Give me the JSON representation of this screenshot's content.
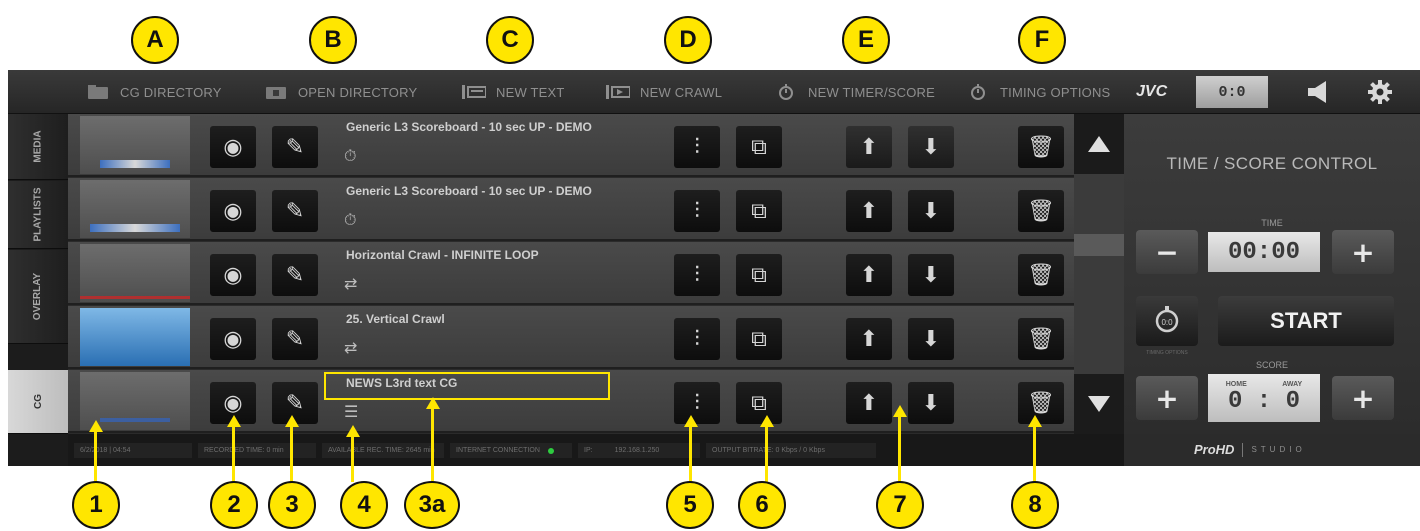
{
  "callouts_top": [
    "A",
    "B",
    "C",
    "D",
    "E",
    "F"
  ],
  "callouts_bottom": [
    "1",
    "2",
    "3",
    "4",
    "3a",
    "5",
    "6",
    "7",
    "8"
  ],
  "toolbar": {
    "cg_directory": "CG DIRECTORY",
    "open_directory": "OPEN DIRECTORY",
    "new_text": "NEW TEXT",
    "new_crawl": "NEW CRAWL",
    "new_timer_score": "NEW TIMER/SCORE",
    "timing_options": "TIMING OPTIONS",
    "brand": "JVC",
    "score_readout": "0:0"
  },
  "sidebar": {
    "tabs": [
      "MEDIA",
      "PLAYLISTS",
      "OVERLAY",
      "CG"
    ],
    "active": "CG"
  },
  "rows": [
    {
      "title": "Generic L3 Scoreboard - 10 sec UP - DEMO",
      "type_icon": "timer-icon"
    },
    {
      "title": "Generic L3 Scoreboard - 10 sec UP - DEMO",
      "type_icon": "timer-icon"
    },
    {
      "title": "Horizontal Crawl - INFINITE LOOP",
      "type_icon": "crawl-arrows-icon"
    },
    {
      "title": "25. Vertical Crawl",
      "type_icon": "crawl-arrows-icon"
    },
    {
      "title": "NEWS L3rd text CG",
      "type_icon": "text-lines-icon"
    }
  ],
  "panel": {
    "title": "TIME / SCORE CONTROL",
    "time_label": "TIME",
    "time_value": "00:00",
    "start": "START",
    "timing_opts_label": "TIMING OPTIONS",
    "score_label": "SCORE",
    "home": "HOME",
    "away": "AWAY",
    "score_value": "0 : 0",
    "minus": "−",
    "plus": "+"
  },
  "status": {
    "date": "6/2/2018 | 04:54",
    "recorded": "RECORDED TIME: 0 min",
    "available": "AVAILABLE REC. TIME: 2645 min",
    "internet": "INTERNET CONNECTION",
    "ip_label": "IP:",
    "ip": "192.168.1.250",
    "bitrate": "OUTPUT BITRATE: 0 Kbps / 0 Kbps"
  },
  "footer_brand": {
    "name": "ProHD",
    "product": "STUDIO"
  },
  "colors": {
    "callout": "#ffe600",
    "internet_ok": "#2ecc40",
    "highlight_box": "#ffe600"
  }
}
